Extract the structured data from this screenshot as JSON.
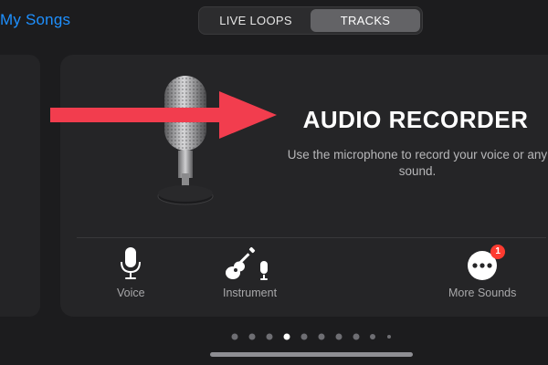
{
  "nav": {
    "back_label": "My Songs"
  },
  "segmented": {
    "tabs": [
      "LIVE LOOPS",
      "TRACKS"
    ],
    "selected": "TRACKS"
  },
  "card": {
    "title": "AUDIO RECORDER",
    "description": "Use the microphone to record your voice or any sound."
  },
  "instruments": [
    {
      "label": "Voice",
      "icon": "microphone-icon"
    },
    {
      "label": "Instrument",
      "icon": "guitar-mic-icon"
    },
    {
      "label": "More Sounds",
      "icon": "ellipsis-icon",
      "badge": "1"
    }
  ],
  "pager": {
    "current_page": 4
  },
  "colors": {
    "accent": "#1e90ff",
    "annotation_arrow": "#f23d4e",
    "badge": "#ff3b30"
  }
}
